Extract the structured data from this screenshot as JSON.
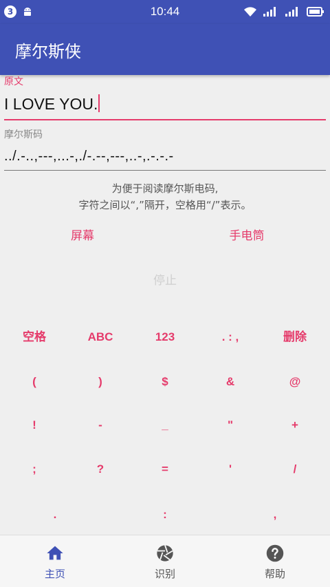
{
  "status_bar": {
    "notification_count": "3",
    "time": "10:44"
  },
  "app_bar": {
    "title": "摩尔斯侠"
  },
  "fields": {
    "original_label": "原文",
    "original_value": "I LOVE YOU.",
    "morse_label": "摩尔斯码",
    "morse_value": "../.-..,---,...-,./-.--,---,..-,.-.-.-"
  },
  "hint": {
    "line1": "为便于阅读摩尔斯电码,",
    "line2": "字符之间以“,”隔开，空格用“/”表示。"
  },
  "actions": {
    "screen": "屏幕",
    "flashlight": "手电筒",
    "stop": "停止"
  },
  "keyboard": {
    "rows": [
      [
        "空格",
        "ABC",
        "123",
        ". : ,",
        "删除"
      ],
      [
        "(",
        ")",
        "$",
        "&",
        "@"
      ],
      [
        "!",
        "-",
        "_",
        "\"",
        "+"
      ],
      [
        ";",
        "?",
        "=",
        "'",
        "/"
      ],
      [
        ".",
        ":",
        ","
      ]
    ]
  },
  "bottom_nav": {
    "items": [
      {
        "label": "主页",
        "icon": "home-icon",
        "active": true
      },
      {
        "label": "识别",
        "icon": "camera-aperture-icon",
        "active": false
      },
      {
        "label": "帮助",
        "icon": "help-icon",
        "active": false
      }
    ]
  },
  "colors": {
    "primary": "#3f51b5",
    "accent": "#e53b6b",
    "inactive_nav": "#555555"
  }
}
